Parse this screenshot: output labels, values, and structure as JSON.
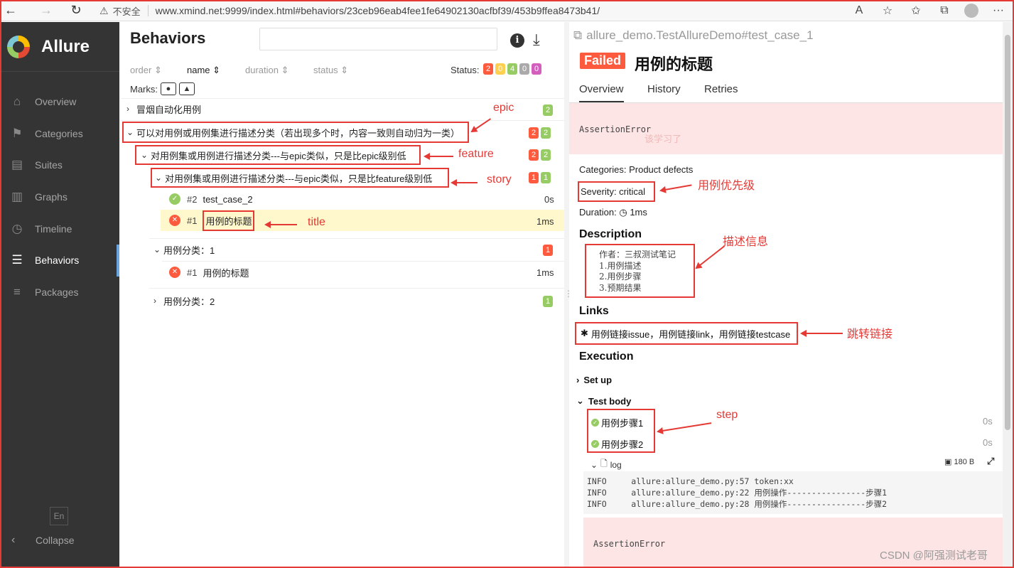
{
  "browser": {
    "back": "←",
    "forward": "→",
    "reload": "↻",
    "warning_icon": "⚠",
    "insecure_label": "不安全",
    "url": "www.xmind.net:9999/index.html#behaviors/23ceb96eab4fee1fe64902130acfbf39/453b9ffea8473b41/"
  },
  "sidebar": {
    "brand": "Allure",
    "items": [
      {
        "label": "Overview",
        "icon": "⌂"
      },
      {
        "label": "Categories",
        "icon": "⚑"
      },
      {
        "label": "Suites",
        "icon": "▤"
      },
      {
        "label": "Graphs",
        "icon": "▥"
      },
      {
        "label": "Timeline",
        "icon": "◷"
      },
      {
        "label": "Behaviors",
        "icon": "☰"
      },
      {
        "label": "Packages",
        "icon": "≡"
      }
    ],
    "lang": "En",
    "collapse": "Collapse",
    "collapse_icon": "‹"
  },
  "behaviors": {
    "title": "Behaviors",
    "sort": {
      "order": "order",
      "name": "name",
      "duration": "duration",
      "status": "status"
    },
    "status_label": "Status:",
    "status_counts": [
      "2",
      "0",
      "4",
      "0",
      "0"
    ],
    "marks_label": "Marks:",
    "tree": {
      "epic1": {
        "label": "冒烟自动化用例",
        "passed": "2"
      },
      "epic2": {
        "label": "可以对用例或用例集进行描述分类（若出现多个时，内容一致则自动归为一类）",
        "failed": "2",
        "passed": "2"
      },
      "feature": {
        "label": "对用例集或用例进行描述分类---与epic类似，只是比epic级别低",
        "failed": "2",
        "passed": "2"
      },
      "story": {
        "label": "对用例集或用例进行描述分类---与epic类似，只是比feature级别低",
        "failed": "1",
        "passed": "1"
      },
      "leaf1": {
        "num": "#2",
        "name": "test_case_2",
        "dur": "0s"
      },
      "leaf2": {
        "num": "#1",
        "name": "用例的标题",
        "dur": "1ms"
      },
      "group1": {
        "label": "用例分类：1",
        "failed": "1"
      },
      "leaf3": {
        "num": "#1",
        "name": "用例的标题",
        "dur": "1ms"
      },
      "group2": {
        "label": "用例分类：2",
        "passed": "1"
      }
    }
  },
  "annotations": {
    "epic": "epic",
    "feature": "feature",
    "story": "story",
    "title": "title",
    "severity": "用例优先级",
    "description": "描述信息",
    "links": "跳转链接",
    "step": "step"
  },
  "testcase": {
    "path": "allure_demo.TestAllureDemo#test_case_1",
    "status": "Failed",
    "title": "用例的标题",
    "tabs": [
      "Overview",
      "History",
      "Retries"
    ],
    "error": "AssertionError",
    "error_ghost": "该学习了",
    "categories": "Categories: Product defects",
    "severity": "Severity: critical",
    "duration": "Duration: ◷ 1ms",
    "description_title": "Description",
    "description_lines": [
      "作者：三叔测试笔记",
      "1.用例描述",
      "2.用例步骤",
      "3.预期结果"
    ],
    "links_title": "Links",
    "links_text": "用例链接issue，用例链接link，用例链接testcase",
    "execution_title": "Execution",
    "setup": "Set up",
    "test_body": "Test body",
    "steps": [
      {
        "name": "用例步骤1",
        "dur": "0s"
      },
      {
        "name": "用例步骤2",
        "dur": "0s"
      }
    ],
    "log_label": "log",
    "log_size": "180 B",
    "log_lines": [
      "INFO     allure:allure_demo.py:57 token:xx",
      "INFO     allure:allure_demo.py:22 用例操作----------------步骤1",
      "INFO     allure:allure_demo.py:28 用例操作----------------步骤2"
    ],
    "error2": "AssertionError"
  },
  "watermark": "CSDN @阿强测试老哥"
}
